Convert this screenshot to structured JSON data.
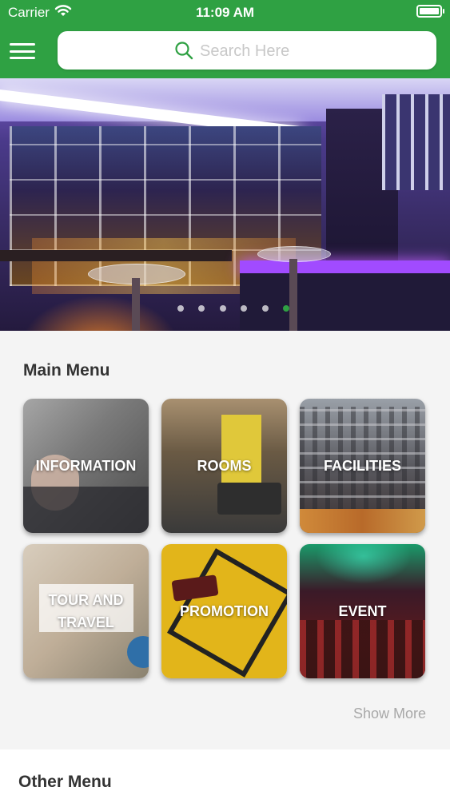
{
  "status_bar": {
    "carrier": "Carrier",
    "time": "11:09 AM"
  },
  "header": {
    "background_color": "#2fa143",
    "menu_icon": "hamburger-icon",
    "search_icon": "search-icon",
    "search_placeholder": "Search Here"
  },
  "banner": {
    "image_subject": "hotel bar lounge",
    "slides_count": 6,
    "active_slide": 6
  },
  "main_menu": {
    "title": "Main Menu",
    "items": [
      {
        "label": "INFORMATION"
      },
      {
        "label": "ROOMS"
      },
      {
        "label": "FACILITIES"
      },
      {
        "label": "TOUR AND TRAVEL"
      },
      {
        "label": "PROMOTION"
      },
      {
        "label": "EVENT"
      }
    ],
    "show_more": "Show More"
  },
  "other_menu": {
    "title": "Other Menu"
  }
}
